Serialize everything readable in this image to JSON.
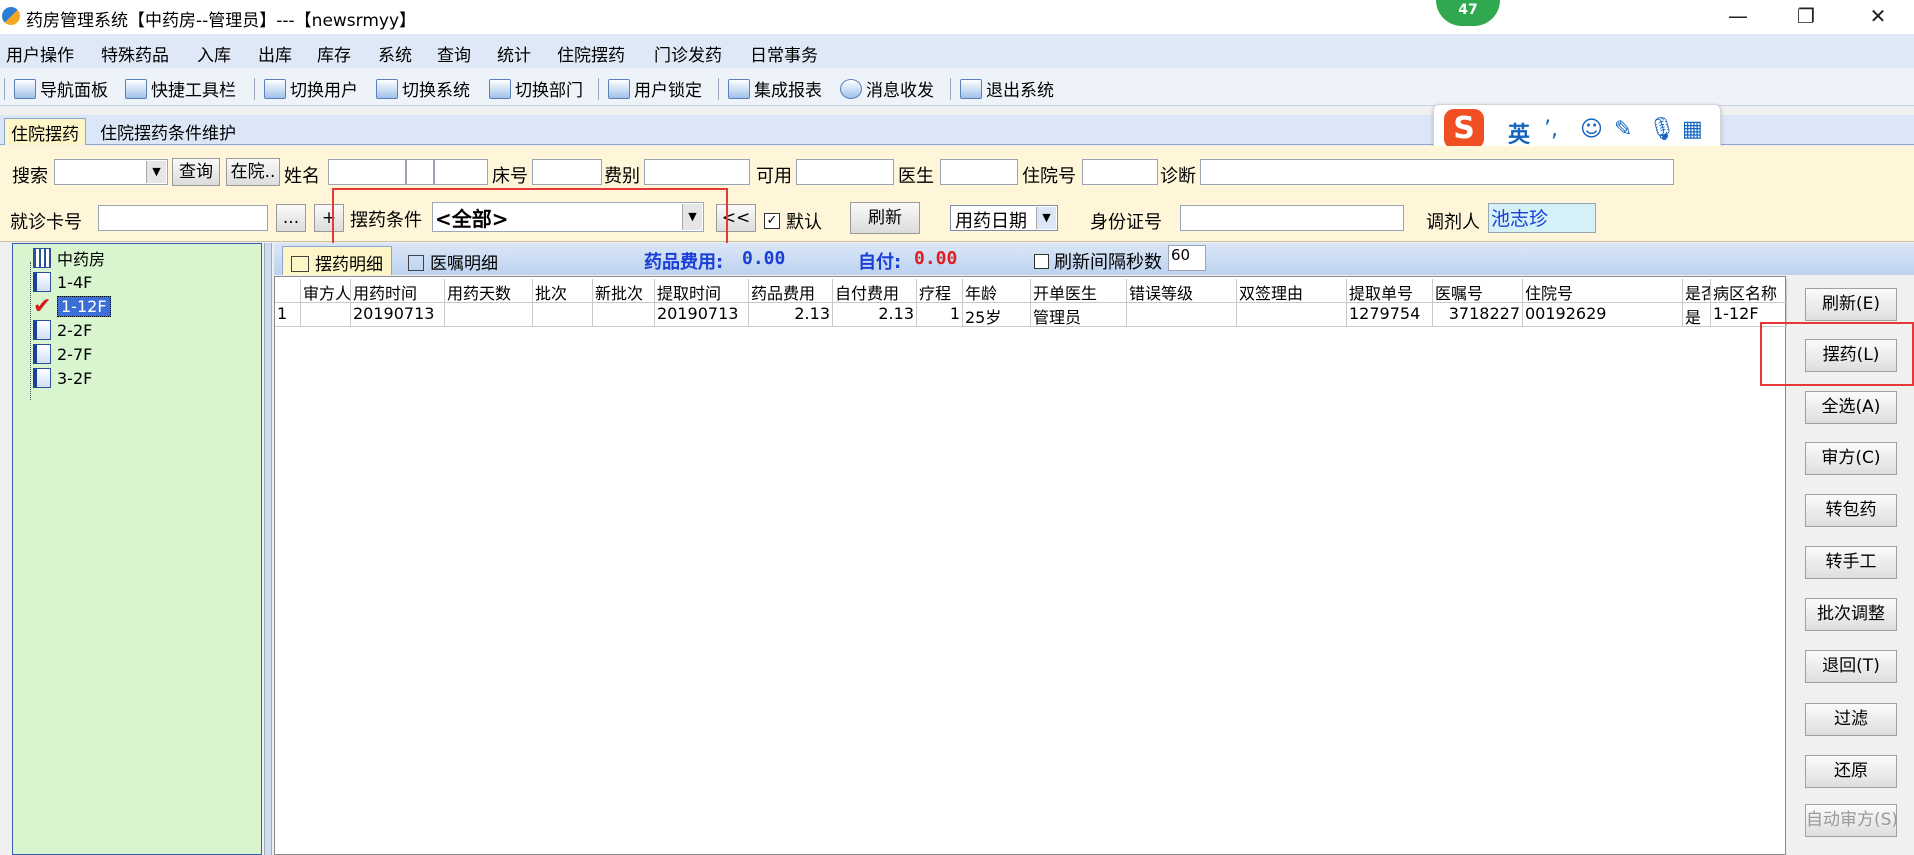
{
  "window": {
    "title": "药房管理系统【中药房--管理员】---【newsrmyy】",
    "badge": "47",
    "minimize": "—",
    "maximize": "❐",
    "close": "✕"
  },
  "menu": [
    "用户操作",
    "特殊药品",
    "入库",
    "出库",
    "库存",
    "系统",
    "查询",
    "统计",
    "住院摆药",
    "门诊发药",
    "日常事务"
  ],
  "toolbar": [
    "导航面板",
    "快捷工具栏",
    "切换用户",
    "切换系统",
    "切换部门",
    "用户锁定",
    "集成报表",
    "消息收发",
    "退出系统"
  ],
  "tabs": [
    "住院摆药",
    "住院摆药条件维护"
  ],
  "ime": {
    "logo": "S",
    "lang": "英"
  },
  "search": {
    "search_label": "搜索",
    "query_button": "查询",
    "inpatient_button": "在院..",
    "name_label": "姓名",
    "bed_label": "床号",
    "fee_label": "费别",
    "available_label": "可用",
    "doctor_label": "医生",
    "hospital_label": "住院号",
    "diagnosis_label": "诊断",
    "card_label": "就诊卡号",
    "card_more": "...",
    "card_plus": "+",
    "condition_label": "摆药条件",
    "condition_value": "<全部>",
    "back_button": "<<",
    "default_label": "默认",
    "refresh_button": "刷新",
    "date_select": "用药日期",
    "id_label": "身份证号",
    "dispenser_label": "调剂人",
    "dispenser_value": "池志珍"
  },
  "tree": {
    "root": "中药房",
    "items": [
      "1-4F",
      "1-12F",
      "2-2F",
      "2-7F",
      "3-2F"
    ]
  },
  "detail_tabs": {
    "active": "摆药明细",
    "other": "医嘱明细",
    "drug_fee_label": "药品费用:",
    "drug_fee_value": "0.00",
    "self_pay_label": "自付:",
    "self_pay_value": "0.00",
    "refresh_interval_label": "刷新间隔秒数",
    "refresh_interval_value": "60"
  },
  "grid": {
    "columns": [
      "",
      "审方人",
      "用药时间",
      "用药天数",
      "批次",
      "新批次",
      "提取时间",
      "药品费用",
      "自付费用",
      "疗程",
      "年龄",
      "开单医生",
      "错误等级",
      "双签理由",
      "提取单号",
      "医嘱号",
      "住院号",
      "是否",
      "病区名称"
    ],
    "rows": [
      [
        "1",
        "",
        "20190713",
        "",
        "",
        "",
        "20190713",
        "2.13",
        "2.13",
        "1",
        "25岁",
        "管理员",
        "",
        "",
        "1279754",
        "3718227",
        "00192629",
        "是",
        "1-12F"
      ]
    ]
  },
  "side_buttons": [
    "刷新(E)",
    "摆药(L)",
    "全选(A)",
    "审方(C)",
    "转包药",
    "转手工",
    "批次调整",
    "退回(T)",
    "过滤",
    "还原",
    "自动审方(S)"
  ],
  "colors": {
    "accent_red": "#e53935",
    "fee_blue": "#1a3fd6",
    "fee_red": "#e02020"
  }
}
